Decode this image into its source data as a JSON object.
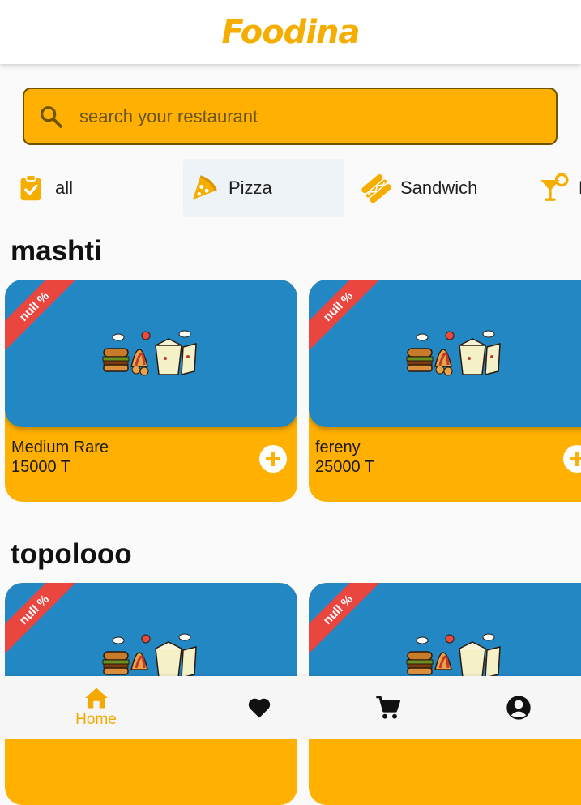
{
  "app": {
    "title": "Foodina"
  },
  "search": {
    "placeholder": "search your restaurant",
    "value": ""
  },
  "categories": [
    {
      "label": "all",
      "icon": "clipboard-check-icon",
      "active": false
    },
    {
      "label": "Pizza",
      "icon": "pizza-icon",
      "active": true
    },
    {
      "label": "Sandwich",
      "icon": "sandwich-icon",
      "active": false
    },
    {
      "label": "D",
      "icon": "cocktail-icon",
      "active": false
    }
  ],
  "sections": [
    {
      "title": "mashti",
      "items": [
        {
          "discount": "null %",
          "name": "Medium Rare",
          "price": "15000 T"
        },
        {
          "discount": "null %",
          "name": "fereny",
          "price": "25000 T"
        }
      ]
    },
    {
      "title": "topolooo",
      "items": [
        {
          "discount": "null %",
          "name": "",
          "price": ""
        },
        {
          "discount": "null %",
          "name": "",
          "price": ""
        }
      ]
    }
  ],
  "bottom_nav": [
    {
      "label": "Home",
      "icon": "home-icon",
      "active": true
    },
    {
      "label": "",
      "icon": "heart-icon",
      "active": false
    },
    {
      "label": "",
      "icon": "cart-icon",
      "active": false
    },
    {
      "label": "",
      "icon": "account-icon",
      "active": false
    }
  ],
  "colors": {
    "accent": "#ffb000",
    "card_image": "#2387c3",
    "ribbon": "#e9463f",
    "title": "#f5ae00"
  }
}
